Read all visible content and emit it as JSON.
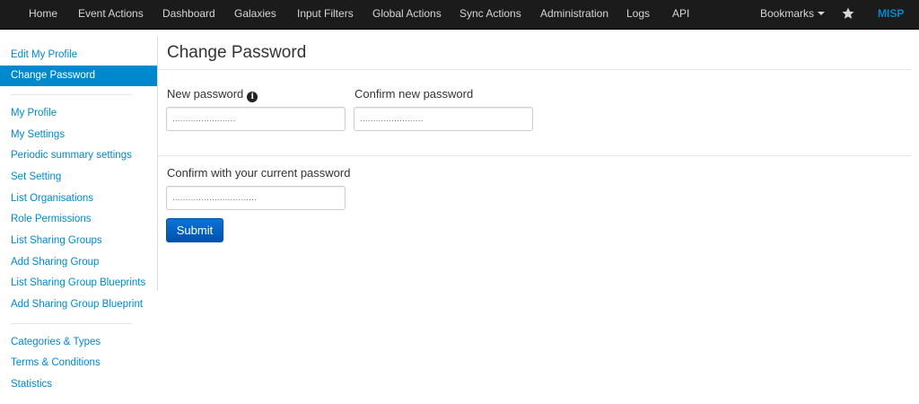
{
  "navbar": {
    "items": [
      "Home",
      "Event Actions",
      "Dashboard",
      "Galaxies",
      "Input Filters",
      "Global Actions",
      "Sync Actions",
      "Administration",
      "Logs",
      "API"
    ],
    "bookmarks": "Bookmarks",
    "brand": "MISP",
    "star_icon": "star-icon"
  },
  "sidebar": {
    "group1": [
      "Edit My Profile",
      "Change Password"
    ],
    "active": "Change Password",
    "group2": [
      "My Profile",
      "My Settings",
      "Periodic summary settings",
      "Set Setting",
      "List Organisations",
      "Role Permissions",
      "List Sharing Groups",
      "Add Sharing Group",
      "List Sharing Group Blueprints",
      "Add Sharing Group Blueprint"
    ],
    "group3": [
      "Categories & Types",
      "Terms & Conditions",
      "Statistics"
    ]
  },
  "main": {
    "title": "Change Password",
    "new_password_label": "New password",
    "new_password_value": "........................",
    "confirm_new_label": "Confirm new password",
    "confirm_new_value": "........................",
    "current_label": "Confirm with your current password",
    "current_value": "................................",
    "submit_label": "Submit",
    "info_icon": "info-icon"
  },
  "colors": {
    "accent": "#0088cc",
    "navbar": "#1b1b1b",
    "button": "#0b6fd0"
  }
}
